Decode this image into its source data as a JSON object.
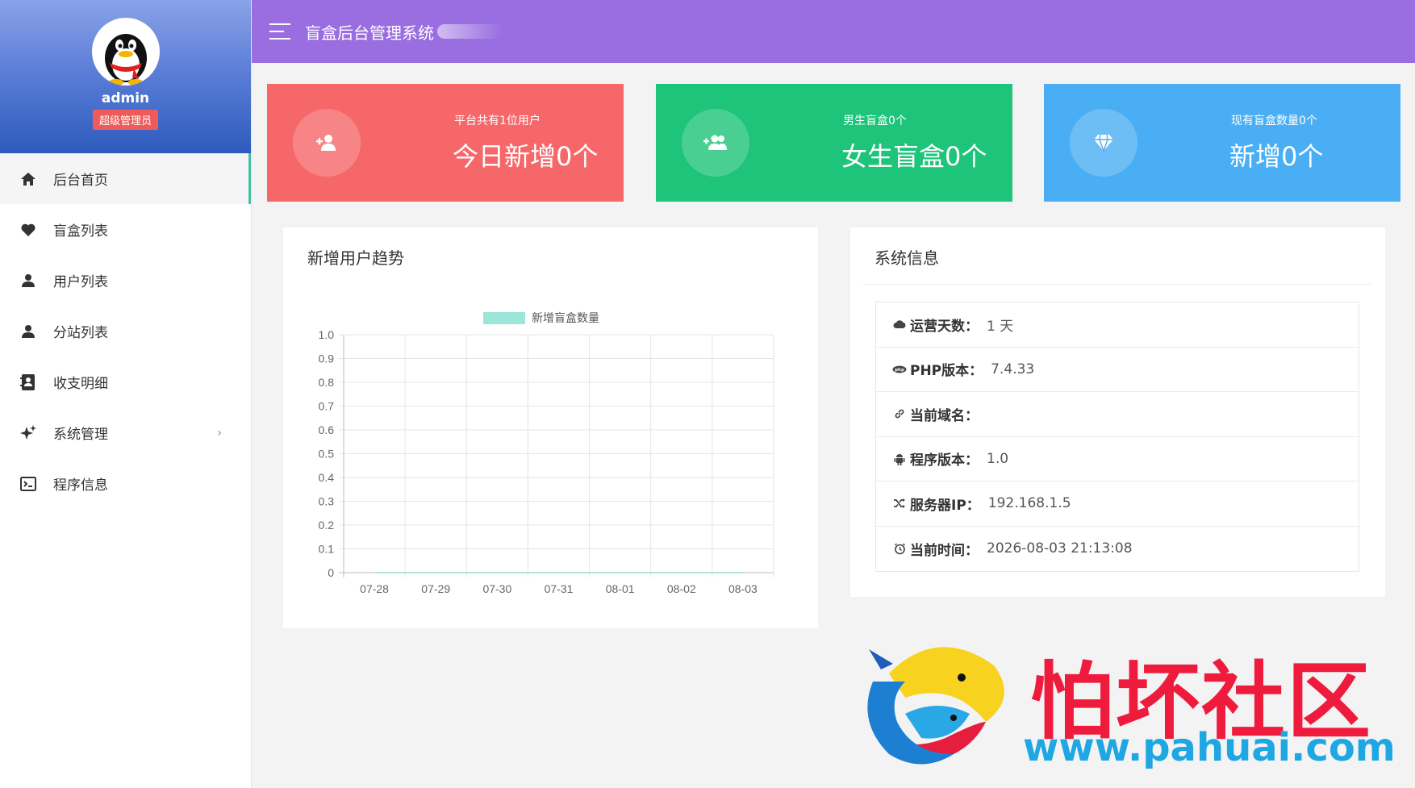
{
  "sidebar": {
    "admin_name": "admin",
    "role": "超级管理员",
    "items": [
      {
        "label": "后台首页",
        "icon": "home-icon",
        "active": true
      },
      {
        "label": "盲盒列表",
        "icon": "heart-icon"
      },
      {
        "label": "用户列表",
        "icon": "user-icon"
      },
      {
        "label": "分站列表",
        "icon": "user-icon"
      },
      {
        "label": "收支明细",
        "icon": "contact-book-icon"
      },
      {
        "label": "系统管理",
        "icon": "sparkles-icon",
        "has_submenu": true
      },
      {
        "label": "程序信息",
        "icon": "terminal-icon"
      }
    ]
  },
  "header": {
    "title": "盲盒后台管理系统"
  },
  "cards": [
    {
      "sub": "平台共有1位用户",
      "main": "今日新增0个",
      "color": "#f6676a",
      "icon": "user-add-icon"
    },
    {
      "sub": "男生盲盒0个",
      "main": "女生盲盒0个",
      "color": "#1dc479",
      "icon": "users-add-icon"
    },
    {
      "sub": "现有盲盒数量0个",
      "main": "新增0个",
      "color": "#4aaef4",
      "icon": "diamond-icon"
    }
  ],
  "chart_panel": {
    "title": "新增用户趋势"
  },
  "chart_data": {
    "type": "line",
    "title": "",
    "x": [
      "07-28",
      "07-29",
      "07-30",
      "07-31",
      "08-01",
      "08-02",
      "08-03"
    ],
    "series": [
      {
        "name": "新增盲盒数量",
        "values": [
          0,
          0,
          0,
          0,
          0,
          0,
          0
        ],
        "color": "#9be6d8"
      }
    ],
    "ylim": [
      0,
      1.0
    ],
    "yticks": [
      "0",
      "0.1",
      "0.2",
      "0.3",
      "0.4",
      "0.5",
      "0.6",
      "0.7",
      "0.8",
      "0.9",
      "1.0"
    ],
    "grid": true,
    "legend": "top"
  },
  "info_panel": {
    "title": "系统信息",
    "rows": [
      {
        "icon": "cloud-icon",
        "label": "运营天数：",
        "value": "1 天"
      },
      {
        "icon": "php-icon",
        "label": "PHP版本：",
        "value": "7.4.33"
      },
      {
        "icon": "link-icon",
        "label": "当前域名：",
        "value": ""
      },
      {
        "icon": "android-icon",
        "label": "程序版本：",
        "value": "1.0"
      },
      {
        "icon": "shuffle-icon",
        "label": "服务器IP：",
        "value": "192.168.1.5"
      },
      {
        "icon": "clock-icon",
        "label": "当前时间：",
        "value": "2026-08-03 21:13:08"
      }
    ]
  },
  "watermark": {
    "text_cn": "怕坏社区",
    "url": "www.pahuai.com"
  }
}
